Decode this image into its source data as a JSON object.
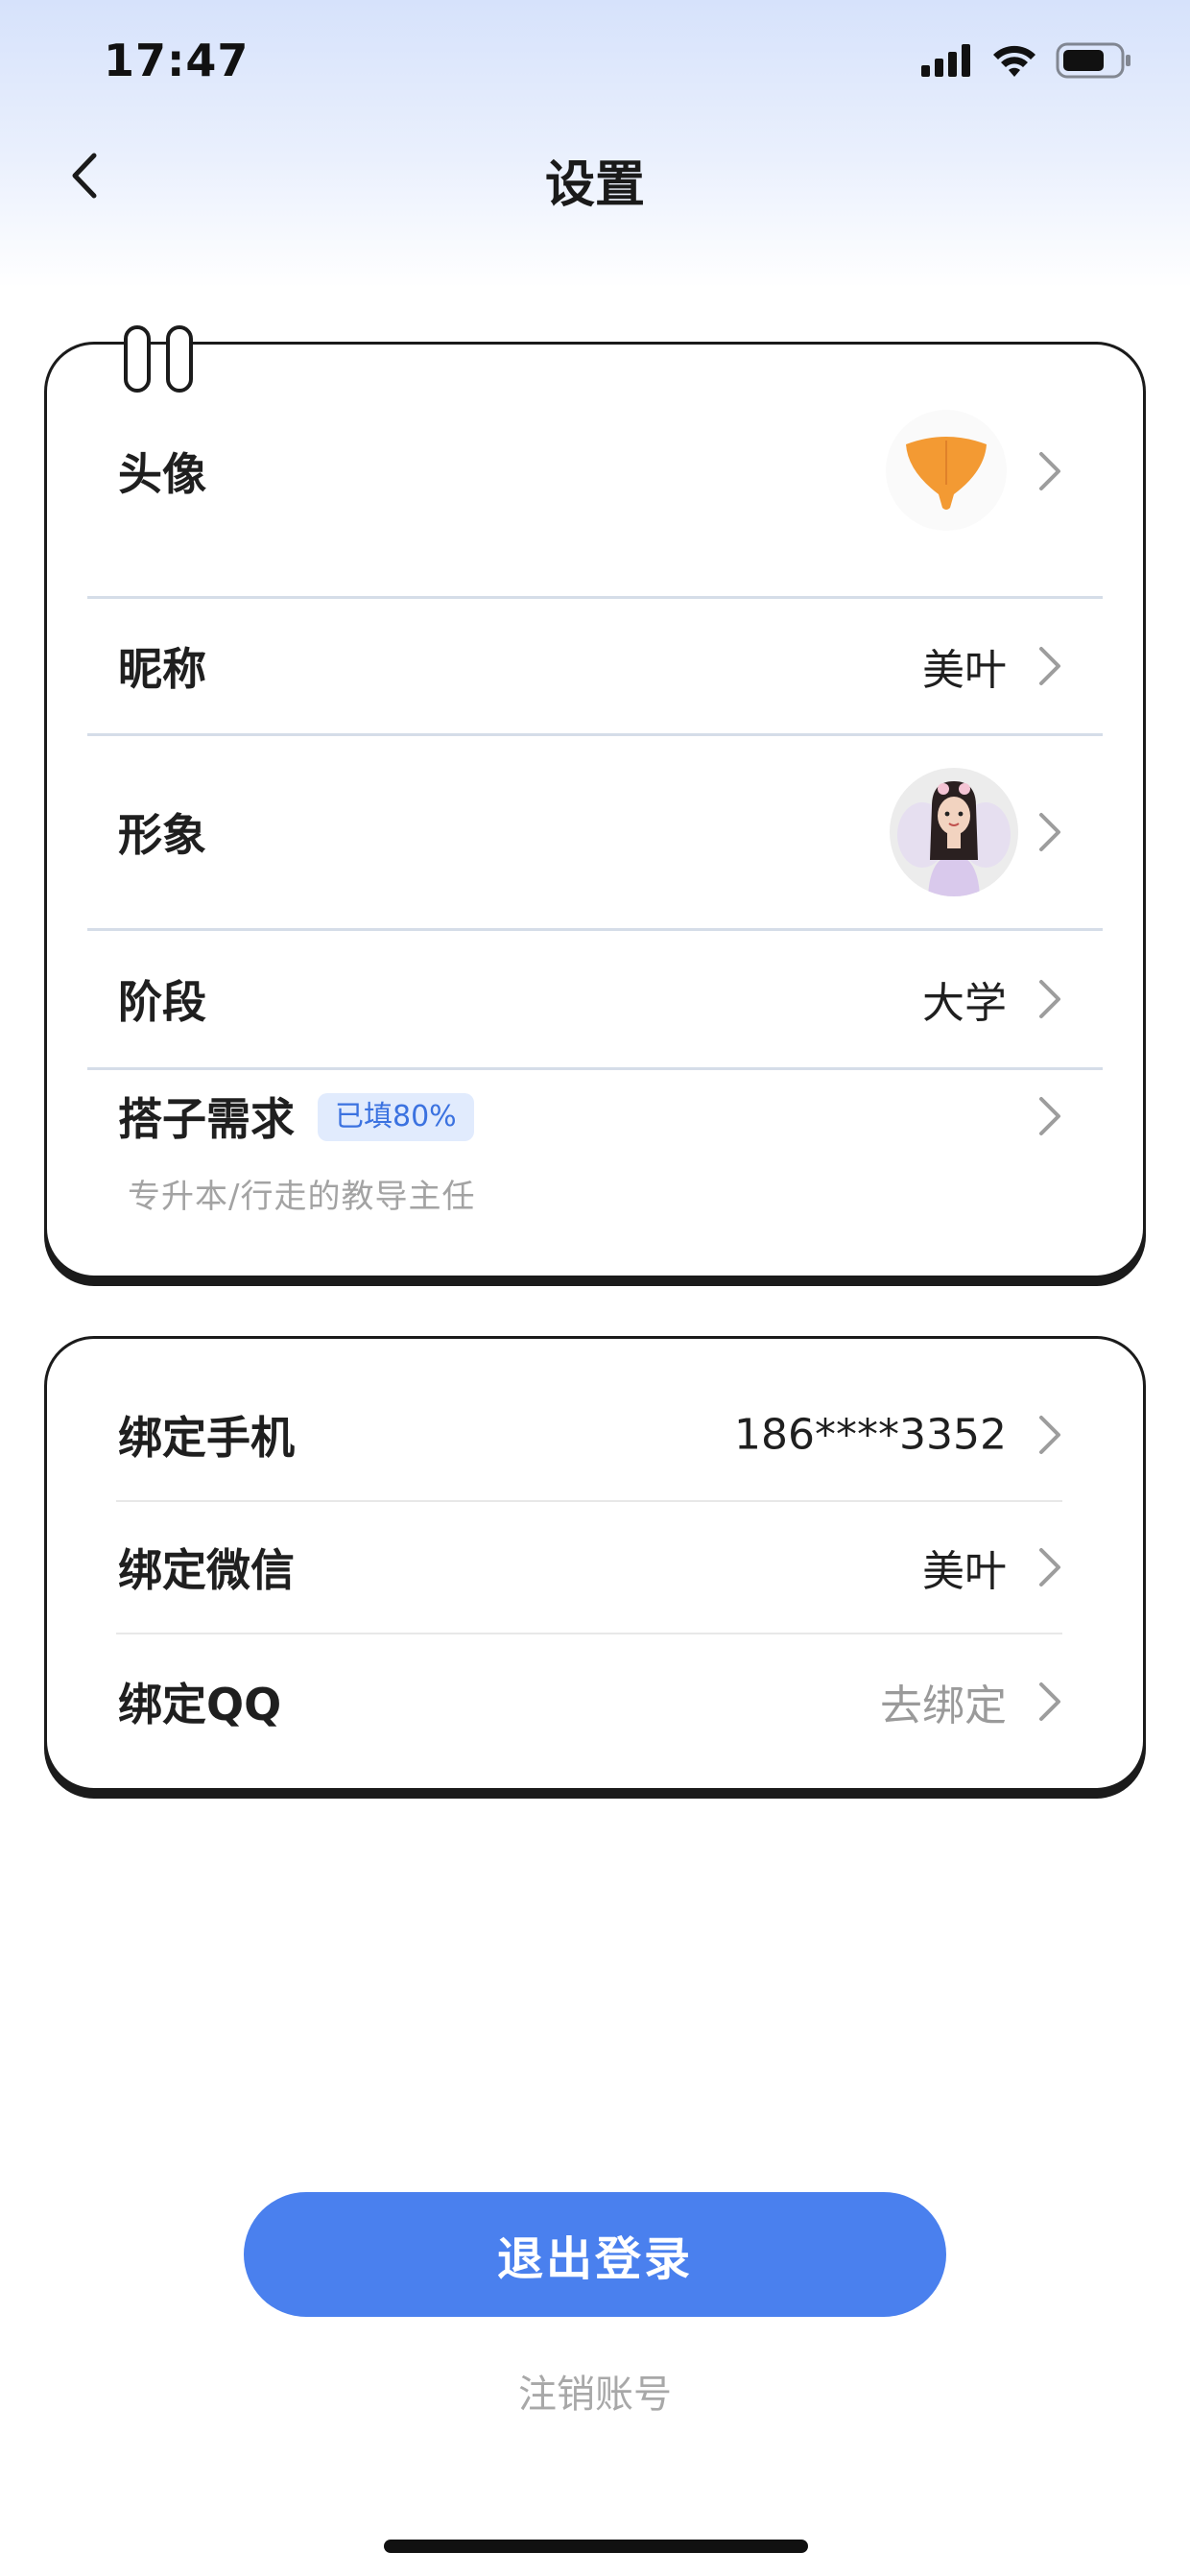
{
  "status_bar": {
    "time": "17:47",
    "icons": [
      "cellular-signal-icon",
      "wifi-icon",
      "battery-icon"
    ]
  },
  "nav": {
    "title": "设置",
    "back_icon": "chevron-left-icon"
  },
  "profile_card": {
    "avatar": {
      "label": "头像",
      "icon": "ginkgo-leaf-icon",
      "icon_color": "#f39a33"
    },
    "nickname": {
      "label": "昵称",
      "value": "美叶"
    },
    "figure": {
      "label": "形象",
      "icon": "fairy-avatar-icon"
    },
    "stage": {
      "label": "阶段",
      "value": "大学"
    },
    "partner_needs": {
      "label": "搭子需求",
      "badge": "已填80%",
      "subtext": "专升本/行走的教导主任"
    }
  },
  "binding_card": {
    "phone": {
      "label": "绑定手机",
      "value": "186****3352"
    },
    "wechat": {
      "label": "绑定微信",
      "value": "美叶"
    },
    "qq": {
      "label": "绑定QQ",
      "value": "去绑定"
    }
  },
  "actions": {
    "logout_label": "退出登录",
    "cancel_account_label": "注销账号"
  },
  "colors": {
    "accent": "#4a80ee",
    "badge_bg": "#e1ebfd",
    "badge_text": "#3b72e0",
    "card_border": "#1b1b1b"
  }
}
